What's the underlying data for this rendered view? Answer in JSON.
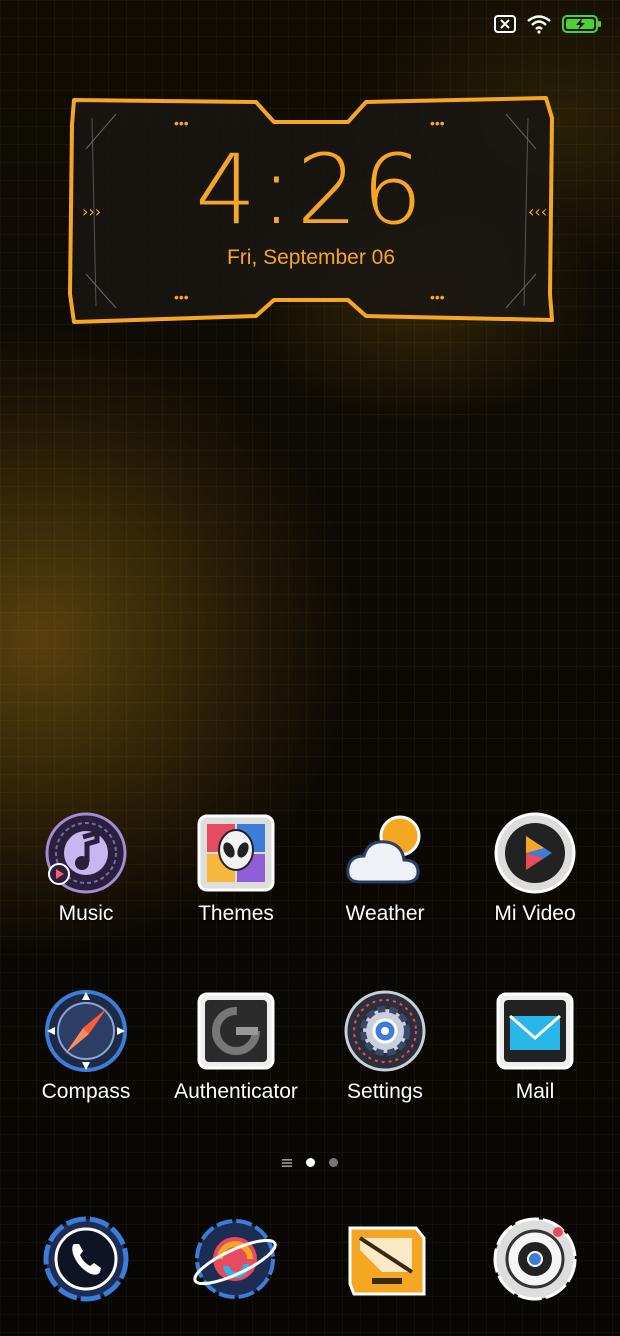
{
  "status_bar": {
    "icons": [
      "sim-x-icon",
      "wifi-icon",
      "battery-charging-icon"
    ],
    "battery_color": "#4cd137"
  },
  "clock": {
    "time": "4:26",
    "date": "Fri, September 06",
    "accent": "#f5a623"
  },
  "apps_row1": [
    {
      "label": "Music",
      "icon": "music-icon"
    },
    {
      "label": "Themes",
      "icon": "themes-icon"
    },
    {
      "label": "Weather",
      "icon": "weather-icon"
    },
    {
      "label": "Mi Video",
      "icon": "mi-video-icon"
    }
  ],
  "apps_row2": [
    {
      "label": "Compass",
      "icon": "compass-icon"
    },
    {
      "label": "Authenticator",
      "icon": "authenticator-icon"
    },
    {
      "label": "Settings",
      "icon": "settings-icon"
    },
    {
      "label": "Mail",
      "icon": "mail-icon"
    }
  ],
  "page_indicator": {
    "pages": 2,
    "current": 1
  },
  "dock": [
    {
      "icon": "phone-icon"
    },
    {
      "icon": "browser-icon"
    },
    {
      "icon": "messages-icon"
    },
    {
      "icon": "camera-icon"
    }
  ]
}
